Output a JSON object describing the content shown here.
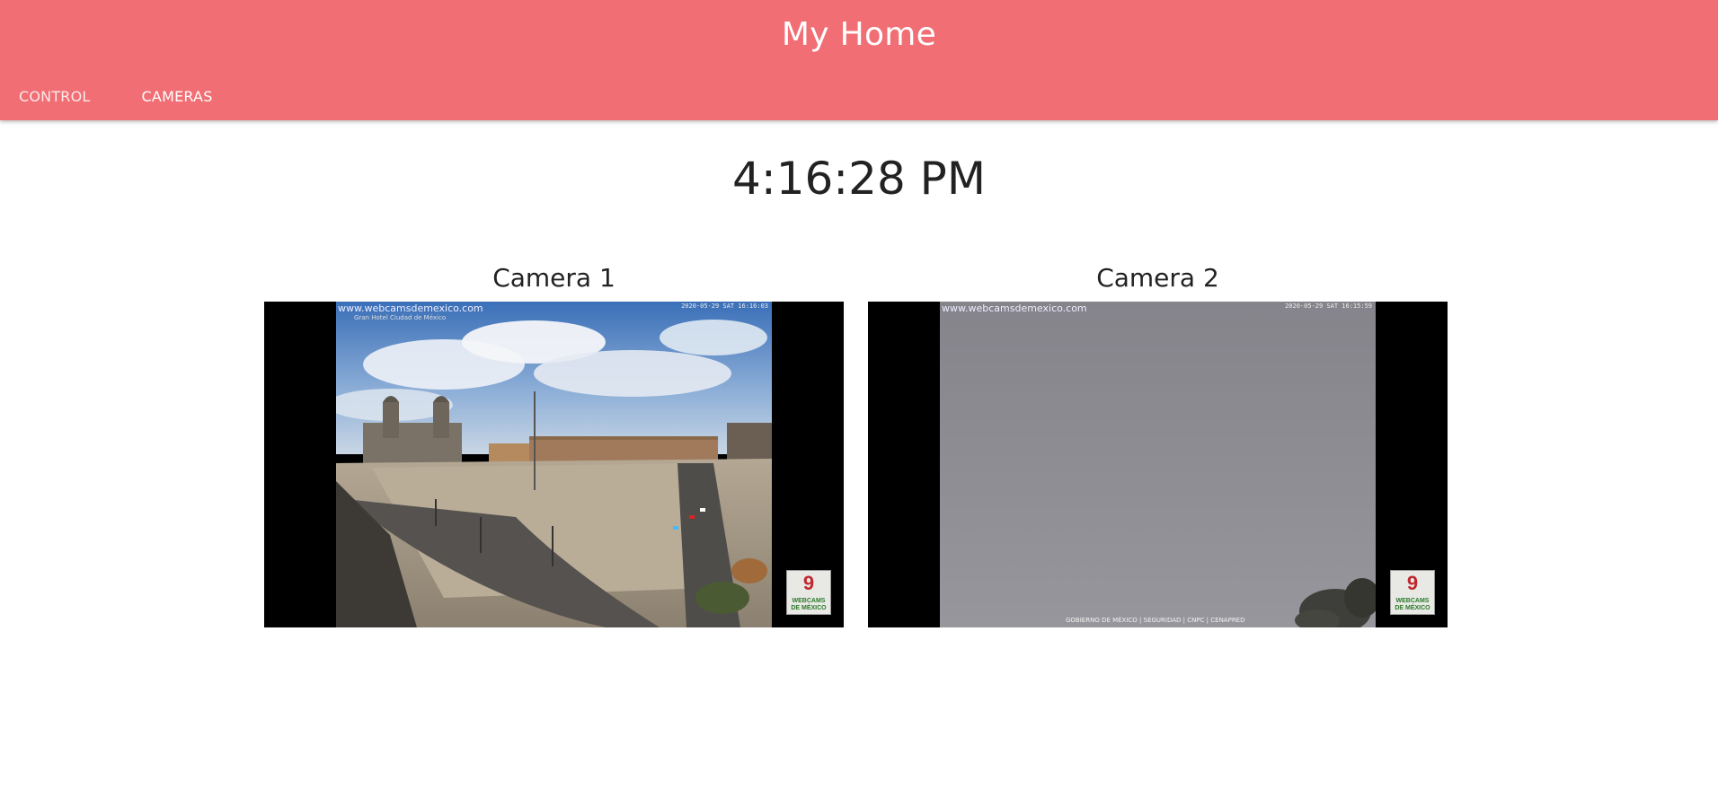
{
  "app": {
    "title": "My Home"
  },
  "tabs": [
    {
      "label": "CONTROL",
      "active": false
    },
    {
      "label": "CAMERAS",
      "active": true
    }
  ],
  "clock": {
    "time": "4:16:28 PM"
  },
  "cameras": [
    {
      "title": "Camera 1",
      "overlay_url": "www.webcamsdemexico.com",
      "overlay_subtitle": "Gran Hotel Ciudad de México",
      "overlay_date": "2020-05-29 SAT 16:16:03",
      "logo_number": "9",
      "logo_text": "WEBCAMS DE MÉXICO"
    },
    {
      "title": "Camera 2",
      "overlay_url": "www.webcamsdemexico.com",
      "overlay_date": "2020-05-29 SAT 16:15:59",
      "footer_logos": "GOBIERNO DE MÉXICO | SEGURIDAD | CNPC | CENAPRED",
      "logo_number": "9",
      "logo_text": "WEBCAMS DE MÉXICO"
    }
  ],
  "colors": {
    "header": "#f06e74",
    "text": "#222222"
  }
}
